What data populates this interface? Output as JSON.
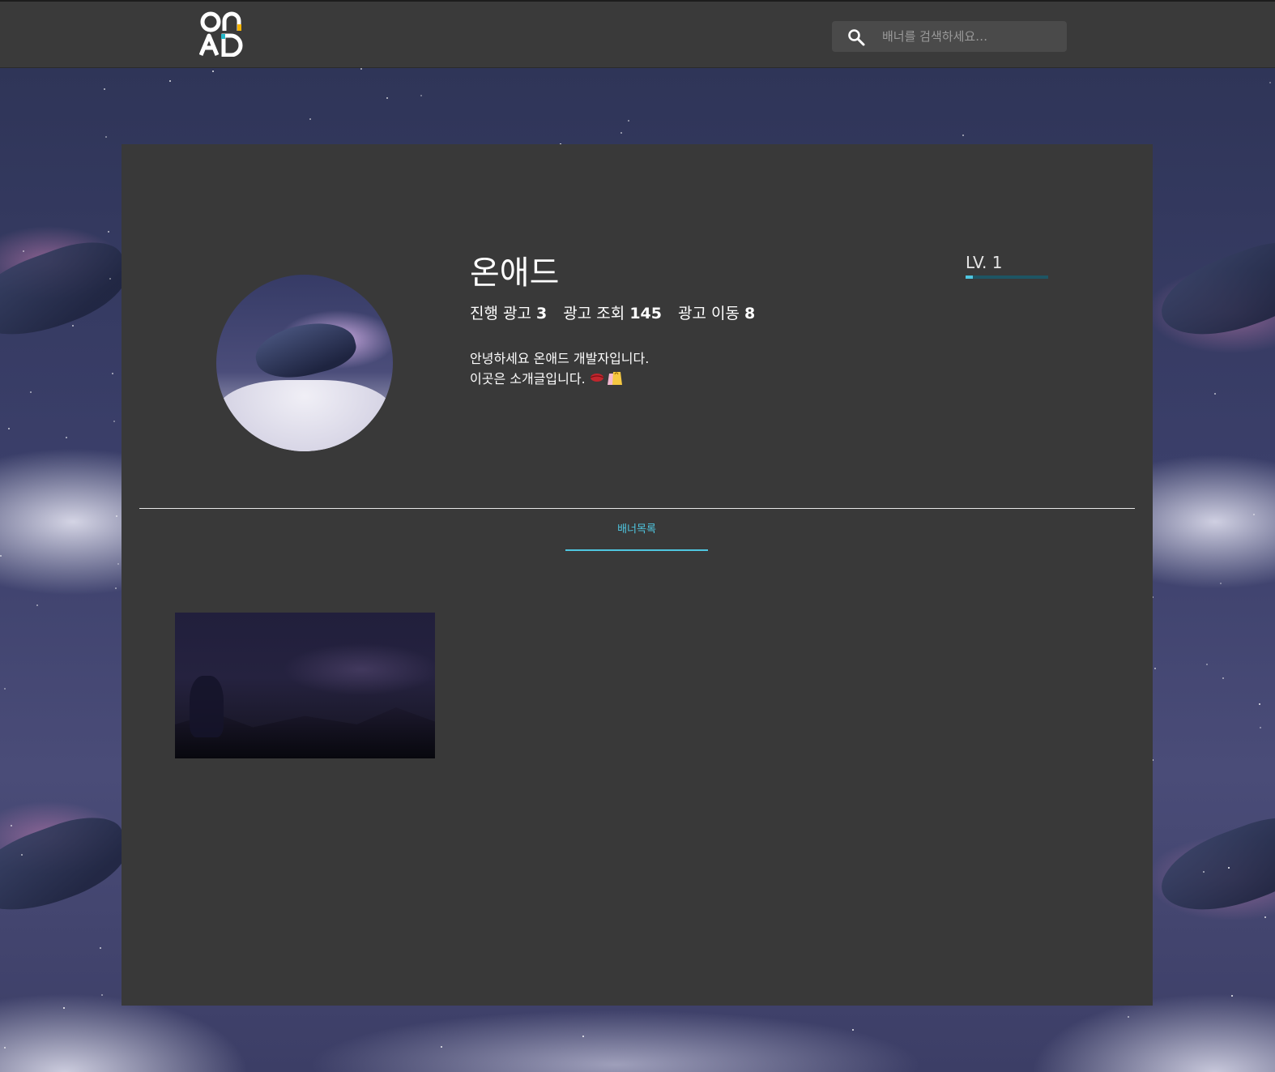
{
  "header": {
    "logo": {
      "text_top": "on",
      "text_bottom": "AD",
      "accent_color": "#f5b400"
    },
    "search": {
      "placeholder": "배너를 검색하세요…",
      "icon": "search-icon"
    }
  },
  "profile": {
    "name": "온애드",
    "stats": [
      {
        "label": "진행 광고",
        "value": "3"
      },
      {
        "label": "광고 조회",
        "value": "145"
      },
      {
        "label": "광고 이동",
        "value": "8"
      }
    ],
    "intro": {
      "line1": "안녕하세요 온애드 개발자입니다.",
      "line2": "이곳은 소개글입니다.",
      "emoji": "💋🛍️"
    },
    "level": {
      "label": "LV. 1",
      "progress_percent": 9
    }
  },
  "tabs": {
    "items": [
      {
        "label": "배너목록",
        "active": true
      }
    ]
  },
  "colors": {
    "accent": "#4fc6e0",
    "card_background": "#393939",
    "topbar_background": "#3a3a3a"
  }
}
